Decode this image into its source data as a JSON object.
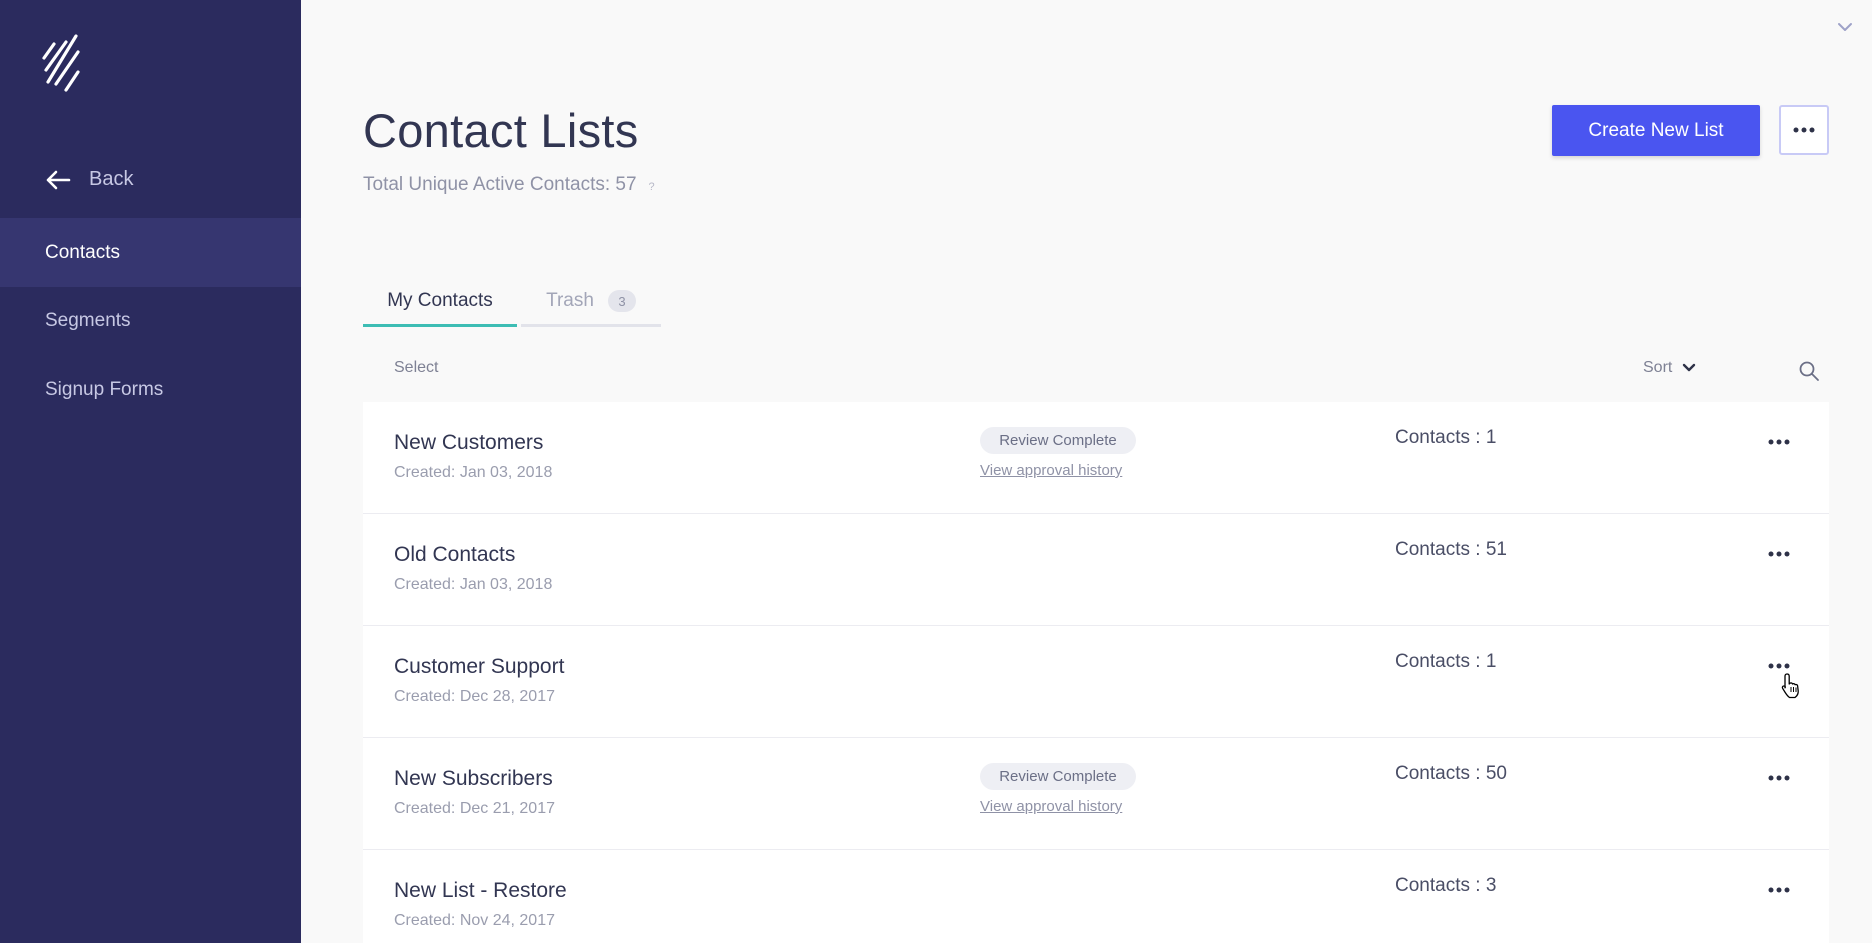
{
  "sidebar": {
    "back_label": "Back",
    "items": [
      {
        "label": "Contacts",
        "active": true
      },
      {
        "label": "Segments",
        "active": false
      },
      {
        "label": "Signup Forms",
        "active": false
      }
    ]
  },
  "header": {
    "title": "Contact Lists",
    "subtitle": "Total Unique Active Contacts: 57",
    "help_mark": "?",
    "create_button": "Create New List"
  },
  "tabs": [
    {
      "label": "My Contacts",
      "active": true
    },
    {
      "label": "Trash",
      "count": "3",
      "active": false
    }
  ],
  "toolbar": {
    "select_label": "Select",
    "sort_label": "Sort"
  },
  "lists": [
    {
      "name": "New Customers",
      "created": "Created: Jan 03, 2018",
      "status": "Review Complete",
      "approval_link": "View approval history",
      "contacts": "Contacts : 1"
    },
    {
      "name": "Old Contacts",
      "created": "Created: Jan 03, 2018",
      "status": "",
      "approval_link": "",
      "contacts": "Contacts : 51"
    },
    {
      "name": "Customer Support",
      "created": "Created: Dec 28, 2017",
      "status": "",
      "approval_link": "",
      "contacts": "Contacts : 1"
    },
    {
      "name": "New Subscribers",
      "created": "Created: Dec 21, 2017",
      "status": "Review Complete",
      "approval_link": "View approval history",
      "contacts": "Contacts : 50"
    },
    {
      "name": "New List - Restore",
      "created": "Created: Nov 24, 2017",
      "status": "",
      "approval_link": "",
      "contacts": "Contacts : 3"
    }
  ],
  "colors": {
    "sidebar_bg": "#2b2b5e",
    "sidebar_active": "#363670",
    "primary_button": "#4a55f0",
    "tab_active_underline": "#3dbdb4"
  },
  "icons": [
    "logo-icon",
    "back-arrow-icon",
    "chevron-down-icon",
    "more-icon",
    "search-icon",
    "pointer-cursor-icon"
  ]
}
